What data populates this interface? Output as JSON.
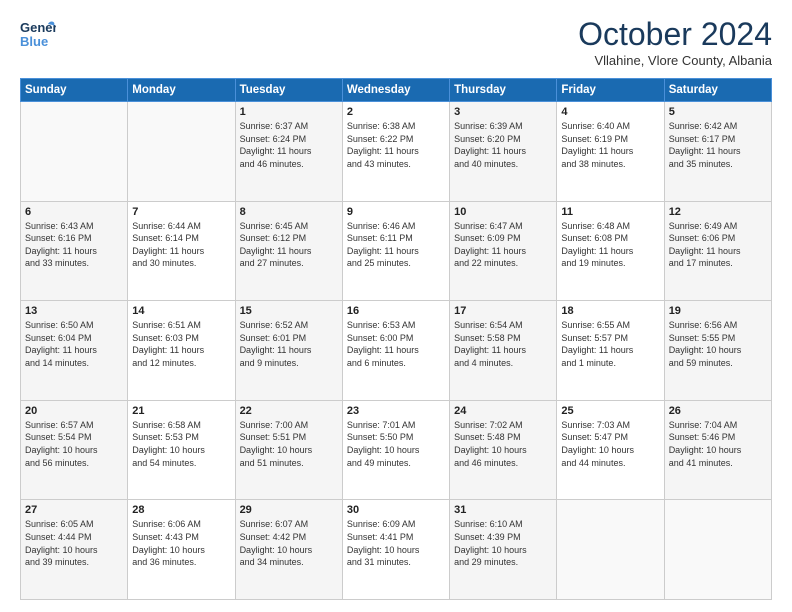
{
  "logo": {
    "line1": "General",
    "line2": "Blue"
  },
  "title": "October 2024",
  "subtitle": "Vllahine, Vlore County, Albania",
  "headers": [
    "Sunday",
    "Monday",
    "Tuesday",
    "Wednesday",
    "Thursday",
    "Friday",
    "Saturday"
  ],
  "weeks": [
    [
      {
        "day": "",
        "info": ""
      },
      {
        "day": "",
        "info": ""
      },
      {
        "day": "1",
        "info": "Sunrise: 6:37 AM\nSunset: 6:24 PM\nDaylight: 11 hours\nand 46 minutes."
      },
      {
        "day": "2",
        "info": "Sunrise: 6:38 AM\nSunset: 6:22 PM\nDaylight: 11 hours\nand 43 minutes."
      },
      {
        "day": "3",
        "info": "Sunrise: 6:39 AM\nSunset: 6:20 PM\nDaylight: 11 hours\nand 40 minutes."
      },
      {
        "day": "4",
        "info": "Sunrise: 6:40 AM\nSunset: 6:19 PM\nDaylight: 11 hours\nand 38 minutes."
      },
      {
        "day": "5",
        "info": "Sunrise: 6:42 AM\nSunset: 6:17 PM\nDaylight: 11 hours\nand 35 minutes."
      }
    ],
    [
      {
        "day": "6",
        "info": "Sunrise: 6:43 AM\nSunset: 6:16 PM\nDaylight: 11 hours\nand 33 minutes."
      },
      {
        "day": "7",
        "info": "Sunrise: 6:44 AM\nSunset: 6:14 PM\nDaylight: 11 hours\nand 30 minutes."
      },
      {
        "day": "8",
        "info": "Sunrise: 6:45 AM\nSunset: 6:12 PM\nDaylight: 11 hours\nand 27 minutes."
      },
      {
        "day": "9",
        "info": "Sunrise: 6:46 AM\nSunset: 6:11 PM\nDaylight: 11 hours\nand 25 minutes."
      },
      {
        "day": "10",
        "info": "Sunrise: 6:47 AM\nSunset: 6:09 PM\nDaylight: 11 hours\nand 22 minutes."
      },
      {
        "day": "11",
        "info": "Sunrise: 6:48 AM\nSunset: 6:08 PM\nDaylight: 11 hours\nand 19 minutes."
      },
      {
        "day": "12",
        "info": "Sunrise: 6:49 AM\nSunset: 6:06 PM\nDaylight: 11 hours\nand 17 minutes."
      }
    ],
    [
      {
        "day": "13",
        "info": "Sunrise: 6:50 AM\nSunset: 6:04 PM\nDaylight: 11 hours\nand 14 minutes."
      },
      {
        "day": "14",
        "info": "Sunrise: 6:51 AM\nSunset: 6:03 PM\nDaylight: 11 hours\nand 12 minutes."
      },
      {
        "day": "15",
        "info": "Sunrise: 6:52 AM\nSunset: 6:01 PM\nDaylight: 11 hours\nand 9 minutes."
      },
      {
        "day": "16",
        "info": "Sunrise: 6:53 AM\nSunset: 6:00 PM\nDaylight: 11 hours\nand 6 minutes."
      },
      {
        "day": "17",
        "info": "Sunrise: 6:54 AM\nSunset: 5:58 PM\nDaylight: 11 hours\nand 4 minutes."
      },
      {
        "day": "18",
        "info": "Sunrise: 6:55 AM\nSunset: 5:57 PM\nDaylight: 11 hours\nand 1 minute."
      },
      {
        "day": "19",
        "info": "Sunrise: 6:56 AM\nSunset: 5:55 PM\nDaylight: 10 hours\nand 59 minutes."
      }
    ],
    [
      {
        "day": "20",
        "info": "Sunrise: 6:57 AM\nSunset: 5:54 PM\nDaylight: 10 hours\nand 56 minutes."
      },
      {
        "day": "21",
        "info": "Sunrise: 6:58 AM\nSunset: 5:53 PM\nDaylight: 10 hours\nand 54 minutes."
      },
      {
        "day": "22",
        "info": "Sunrise: 7:00 AM\nSunset: 5:51 PM\nDaylight: 10 hours\nand 51 minutes."
      },
      {
        "day": "23",
        "info": "Sunrise: 7:01 AM\nSunset: 5:50 PM\nDaylight: 10 hours\nand 49 minutes."
      },
      {
        "day": "24",
        "info": "Sunrise: 7:02 AM\nSunset: 5:48 PM\nDaylight: 10 hours\nand 46 minutes."
      },
      {
        "day": "25",
        "info": "Sunrise: 7:03 AM\nSunset: 5:47 PM\nDaylight: 10 hours\nand 44 minutes."
      },
      {
        "day": "26",
        "info": "Sunrise: 7:04 AM\nSunset: 5:46 PM\nDaylight: 10 hours\nand 41 minutes."
      }
    ],
    [
      {
        "day": "27",
        "info": "Sunrise: 6:05 AM\nSunset: 4:44 PM\nDaylight: 10 hours\nand 39 minutes."
      },
      {
        "day": "28",
        "info": "Sunrise: 6:06 AM\nSunset: 4:43 PM\nDaylight: 10 hours\nand 36 minutes."
      },
      {
        "day": "29",
        "info": "Sunrise: 6:07 AM\nSunset: 4:42 PM\nDaylight: 10 hours\nand 34 minutes."
      },
      {
        "day": "30",
        "info": "Sunrise: 6:09 AM\nSunset: 4:41 PM\nDaylight: 10 hours\nand 31 minutes."
      },
      {
        "day": "31",
        "info": "Sunrise: 6:10 AM\nSunset: 4:39 PM\nDaylight: 10 hours\nand 29 minutes."
      },
      {
        "day": "",
        "info": ""
      },
      {
        "day": "",
        "info": ""
      }
    ]
  ]
}
